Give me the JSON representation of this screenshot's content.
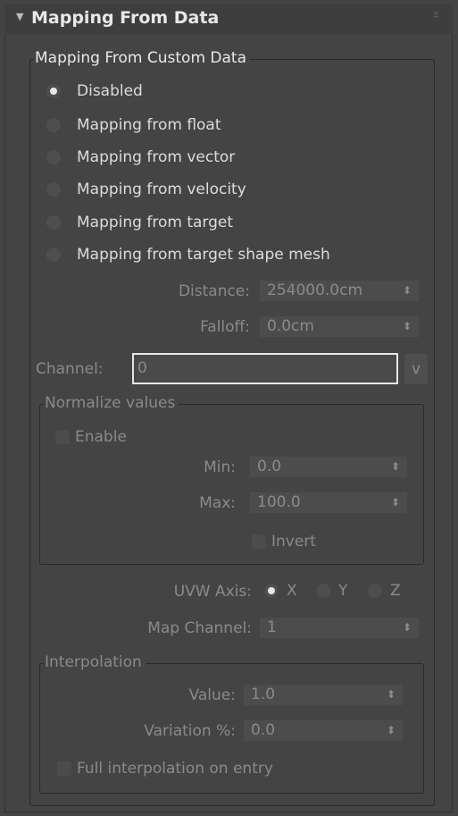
{
  "rollout": {
    "title": "Mapping From Data"
  },
  "custom_group": {
    "label": "Mapping From Custom Data",
    "options": [
      {
        "label": "Disabled",
        "selected": true
      },
      {
        "label": "Mapping from float",
        "selected": false
      },
      {
        "label": "Mapping from vector",
        "selected": false
      },
      {
        "label": "Mapping from velocity",
        "selected": false
      },
      {
        "label": "Mapping from target",
        "selected": false
      },
      {
        "label": "Mapping from target shape mesh",
        "selected": false
      }
    ],
    "distance": {
      "label": "Distance:",
      "value": "254000.0cm"
    },
    "falloff": {
      "label": "Falloff:",
      "value": "0.0cm"
    },
    "channel": {
      "label": "Channel:",
      "value": "0",
      "button": "v"
    },
    "normalize": {
      "label": "Normalize values",
      "enable": "Enable",
      "min": {
        "label": "Min:",
        "value": "0.0"
      },
      "max": {
        "label": "Max:",
        "value": "100.0"
      },
      "invert": "Invert"
    },
    "uvw_axis": {
      "label": "UVW Axis:",
      "options": [
        "X",
        "Y",
        "Z"
      ],
      "selected": "X"
    },
    "map_channel": {
      "label": "Map Channel:",
      "value": "1"
    },
    "interpolation": {
      "label": "Interpolation",
      "value": {
        "label": "Value:",
        "value": "1.0"
      },
      "variation": {
        "label": "Variation %:",
        "value": "0.0"
      },
      "full_entry": "Full interpolation on entry"
    }
  },
  "icons": {
    "spinner": "up-down-arrows",
    "collapse": "triangle-down"
  }
}
